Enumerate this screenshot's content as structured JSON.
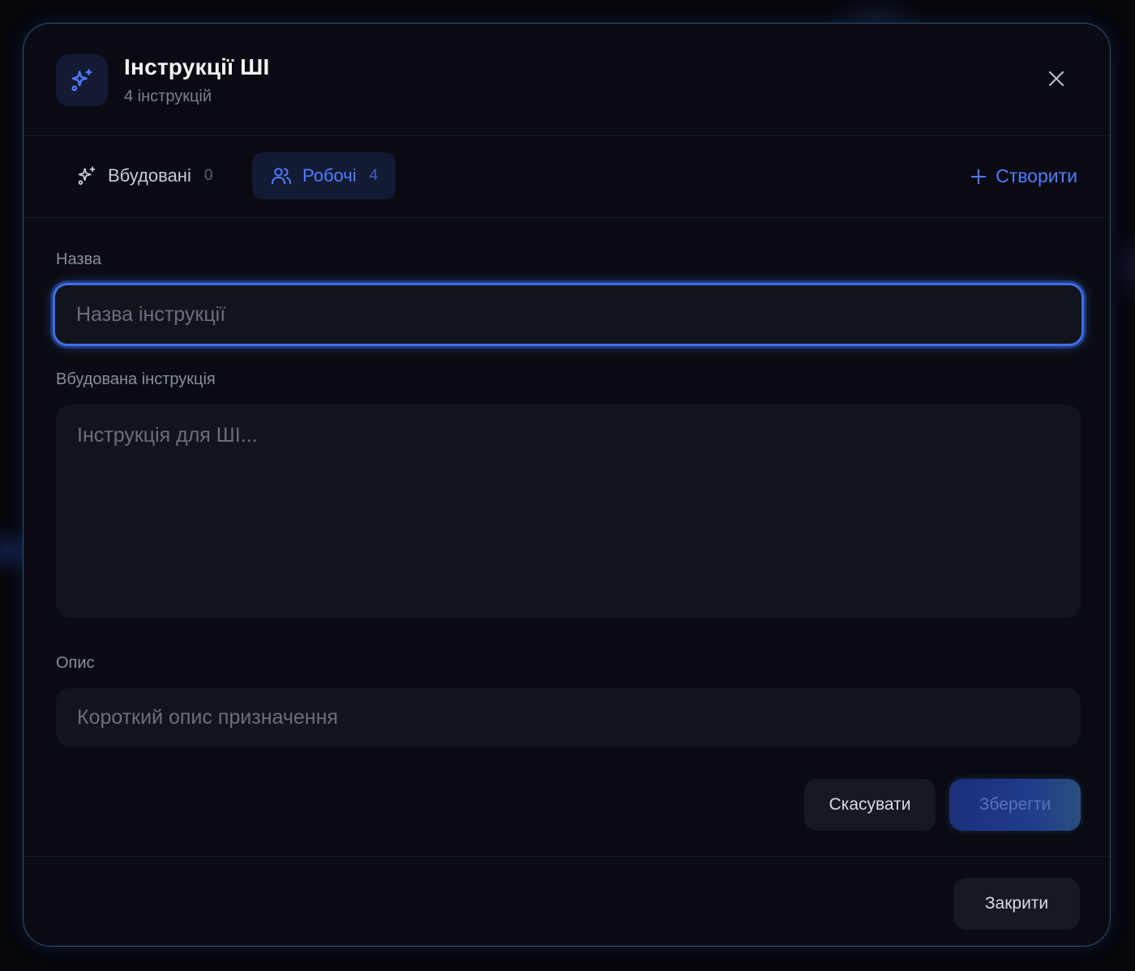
{
  "header": {
    "title": "Інструкції ШІ",
    "subtitle": "4 інструкцій",
    "icon": "sparkles-icon",
    "close_icon": "close-icon"
  },
  "tabs": [
    {
      "label": "Вбудовані",
      "count": "0",
      "icon": "sparkles-icon",
      "active": false
    },
    {
      "label": "Робочі",
      "count": "4",
      "icon": "users-icon",
      "active": true
    }
  ],
  "create_button": {
    "label": "Створити",
    "icon": "plus-icon"
  },
  "form": {
    "name": {
      "label": "Назва",
      "placeholder": "Назва інструкції",
      "value": ""
    },
    "instruction": {
      "label": "Вбудована інструкція",
      "placeholder": "Інструкція для ШІ...",
      "value": ""
    },
    "description": {
      "label": "Опис",
      "placeholder": "Короткий опис призначення",
      "value": ""
    }
  },
  "actions": {
    "cancel_label": "Скасувати",
    "save_label": "Зберегти"
  },
  "footer": {
    "close_label": "Закрити"
  },
  "colors": {
    "accent": "#4f7cff",
    "modal_border": "#2a4a70",
    "background": "#0a0b12"
  }
}
